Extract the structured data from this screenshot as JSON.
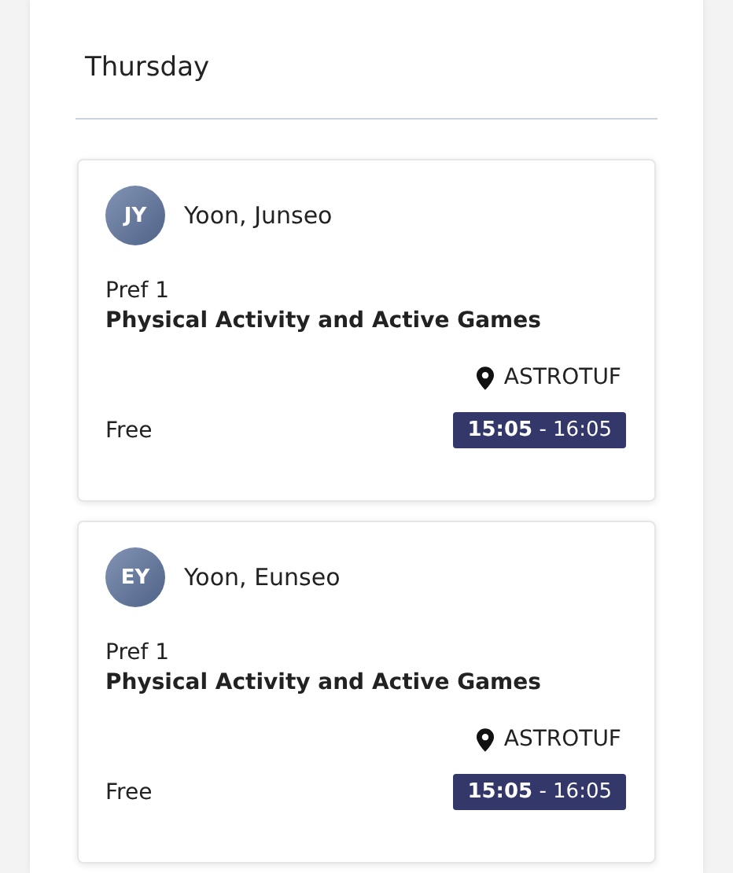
{
  "day": {
    "title": "Thursday"
  },
  "bookings": [
    {
      "initials": "JY",
      "name": "Yoon, Junseo",
      "preference": "Pref 1",
      "activity": "Physical Activity and Active Games",
      "location": "ASTROTUF",
      "price": "Free",
      "time": "**15:05** - 16:05"
    },
    {
      "initials": "EY",
      "name": "Yoon, Eunseo",
      "preference": "Pref 1",
      "activity": "Physical Activity and Active Games",
      "location": "ASTROTUF",
      "price": "Free",
      "time": "**15:05** - 16:05"
    }
  ]
}
